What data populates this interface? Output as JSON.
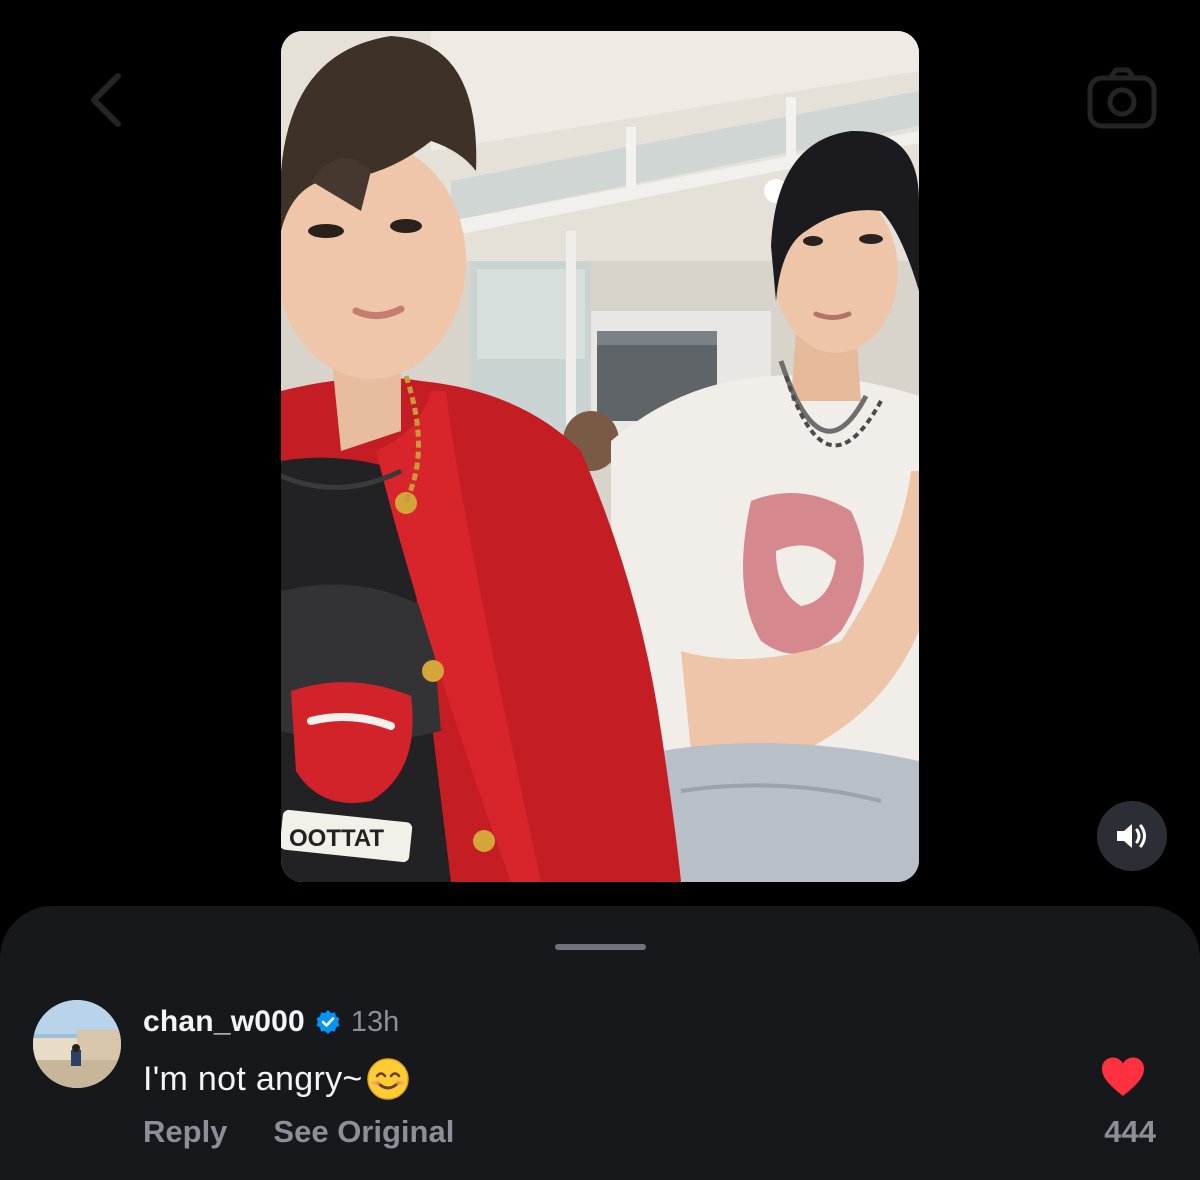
{
  "colors": {
    "background": "#000000",
    "sheet": "#16181c",
    "primary_text": "#f3f5f7",
    "secondary_text": "#8a8f98",
    "verified_badge": "#0095f6",
    "like_red": "#ff3040"
  },
  "header": {
    "back_icon": "chevron-left-icon",
    "camera_icon": "camera-icon"
  },
  "media": {
    "type": "video",
    "sound_icon": "speaker-on-icon"
  },
  "comment": {
    "username": "chan_w000",
    "verified": true,
    "time": "13h",
    "text": "I'm not angry~",
    "emoji": "smiling-face-icon",
    "reply_label": "Reply",
    "see_original_label": "See Original",
    "liked": true,
    "like_count": "444"
  }
}
